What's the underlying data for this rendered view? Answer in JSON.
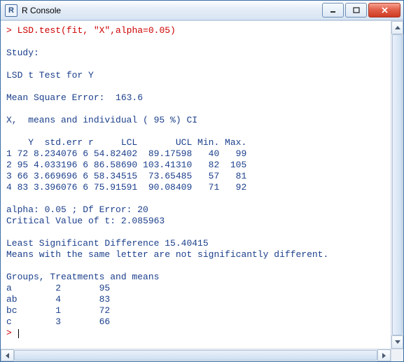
{
  "window": {
    "app_letter": "R",
    "title": "R Console"
  },
  "console": {
    "prompt": ">",
    "command": "LSD.test(fit, \"X\",alpha=0.05)",
    "blank1": "",
    "study": "Study:",
    "blank2": "",
    "testfor": "LSD t Test for Y",
    "blank3": "",
    "mse": "Mean Square Error:  163.6",
    "blank4": "",
    "ci_header": "X,  means and individual ( 95 %) CI",
    "blank5": "",
    "tbl_hdr": "    Y  std.err r     LCL       UCL Min. Max.",
    "r1": "1 72 8.234076 6 54.82402  89.17598   40   99",
    "r2": "2 95 4.033196 6 86.58690 103.41310   82  105",
    "r3": "3 66 3.669696 6 58.34515  73.65485   57   81",
    "r4": "4 83 3.396076 6 75.91591  90.08409   71   92",
    "blank6": "",
    "alpha": "alpha: 0.05 ; Df Error: 20",
    "crit": "Critical Value of t: 2.085963",
    "blank7": "",
    "lsd": "Least Significant Difference 15.40415",
    "note": "Means with the same letter are not significantly different.",
    "blank8": "",
    "grp_hdr": "Groups, Treatments and means",
    "g1": "a \t 2 \t 95 ",
    "g2": "ab \t 4 \t 83 ",
    "g3": "bc \t 1 \t 72 ",
    "g4": "c \t 3 \t 66 ",
    "prompt2": "> "
  }
}
